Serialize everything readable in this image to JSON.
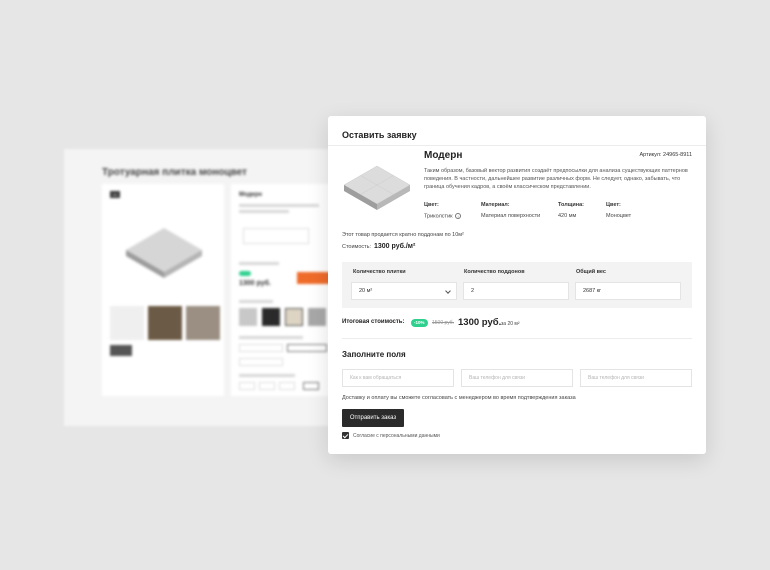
{
  "background_page": {
    "title": "Тротуарная плитка моноцвет",
    "product_title": "Модерн",
    "price": "1300 руб."
  },
  "modal": {
    "title": "Оставить заявку",
    "product": {
      "name": "Модерн",
      "sku": "Артикул: 24965-8911",
      "description": "Таким образом, базовый вектор развития создаёт предпосылки для анализа существующих паттернов поведения. В частности, дальнейшее развитие различных форм. Не следует, однако, забывать, что граница обучения кадров, а своём классическом представлении."
    },
    "specs": [
      {
        "label": "Цвет:",
        "value": "Триколстик"
      },
      {
        "label": "Материал:",
        "value": "Материал поверхности"
      },
      {
        "label": "Толщина:",
        "value": "420 мм"
      },
      {
        "label": "Цвет:",
        "value": "Моноцвет"
      }
    ],
    "note": "Этот товар продается кратно поддонам по 10м²",
    "cost_label": "Стоимость:",
    "cost_value": "1300 руб./м²",
    "calculator": {
      "qty_label": "Количество плитки",
      "qty_value": "20 м²",
      "pallets_label": "Количество поддонов",
      "pallets_value": "2",
      "weight_label": "Общий вес",
      "weight_value": "2687 кг"
    },
    "total": {
      "label": "Итоговая стоимость:",
      "discount": "-10%",
      "old_price": "1500 руб.",
      "new_price": "1300 руб.",
      "per": "за 20 м²"
    },
    "form": {
      "title": "Заполните поля",
      "name_placeholder": "Как к вам обращаться",
      "phone_placeholder": "Ваш телефон для связи",
      "phone2_placeholder": "Ваш телефон для связи",
      "delivery_note": "Доставку и оплату вы сможете согласовать с менеджером во время подтверждения заказа",
      "submit_label": "Отправить заказ",
      "consent_label": "Согласие с персональными данными"
    }
  }
}
